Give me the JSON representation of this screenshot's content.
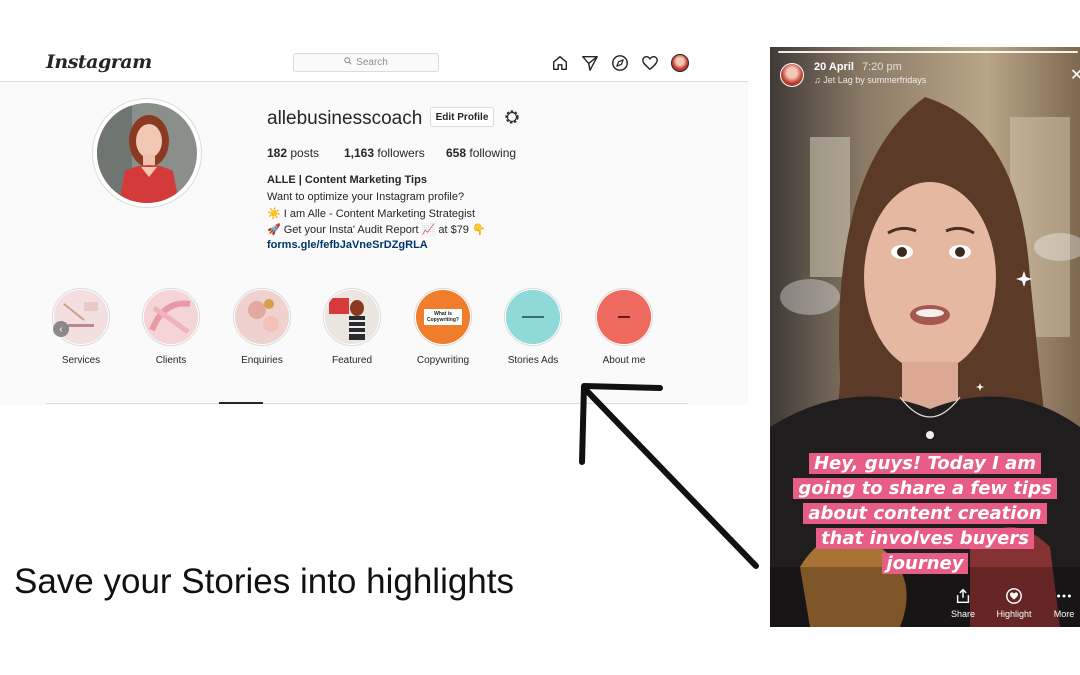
{
  "header": {
    "logo": "Instagram",
    "search_placeholder": "Search",
    "nav_icons": [
      "home-icon",
      "direct-icon",
      "explore-icon",
      "heart-icon",
      "profile-avatar"
    ]
  },
  "profile": {
    "username": "allebusinesscoach",
    "edit_button": "Edit Profile",
    "stats": {
      "posts_count": "182",
      "posts_label": "posts",
      "followers_count": "1,163",
      "followers_label": "followers",
      "following_count": "658",
      "following_label": "following"
    },
    "bio": {
      "name": "ALLE | Content Marketing Tips",
      "line1": "Want to optimize your Instagram profile?",
      "line2": "☀️ I am Alle - Content Marketing Strategist",
      "line3": "🚀 Get your Insta' Audit Report 📈 at $79 👇",
      "link": "forms.gle/fefbJaVneSrDZgRLA"
    }
  },
  "highlights": [
    {
      "label": "Services",
      "cover_text": "",
      "color": "#f3dfe0"
    },
    {
      "label": "Clients",
      "cover_text": "",
      "color": "#f2c6cc"
    },
    {
      "label": "Enquiries",
      "cover_text": "",
      "color": "#efd2cf"
    },
    {
      "label": "Featured",
      "cover_text": "",
      "color": "#e9e2dc"
    },
    {
      "label": "Copywriting",
      "cover_text": "What is Copywriting?",
      "color": "#f07d2c"
    },
    {
      "label": "Stories Ads",
      "cover_text": "",
      "color": "#8fd9d9"
    },
    {
      "label": "About me",
      "cover_text": "",
      "color": "#ee6a5f"
    }
  ],
  "caption": "Save your Stories into highlights",
  "story": {
    "date": "20 April",
    "time": "7:20 pm",
    "music": "♫ Jet Lag by summerfridays",
    "text_lines": [
      "Hey, guys! Today I am",
      "going to share a few tips",
      "about content creation",
      "that involves buyers",
      "journey"
    ],
    "highlight_color": "#e85d86",
    "actions": [
      {
        "label": "Share",
        "icon": "share-icon"
      },
      {
        "label": "Highlight",
        "icon": "highlight-heart-icon"
      },
      {
        "label": "More",
        "icon": "more-icon"
      }
    ]
  }
}
